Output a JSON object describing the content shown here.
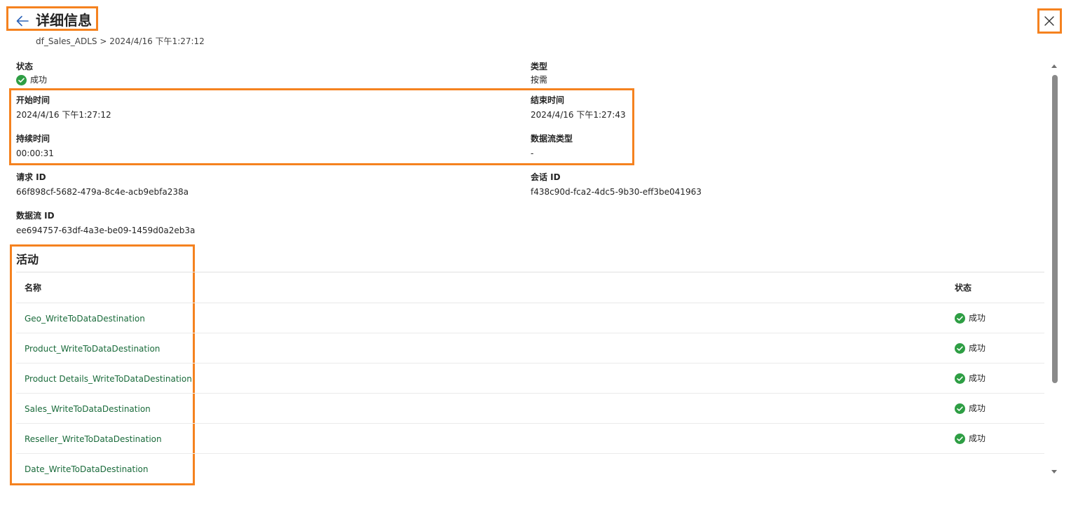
{
  "header": {
    "title": "详细信息",
    "breadcrumb": "df_Sales_ADLS > 2024/4/16 下午1:27:12"
  },
  "details": {
    "status_label": "状态",
    "status_value": "成功",
    "type_label": "类型",
    "type_value": "按需",
    "start_label": "开始时间",
    "start_value": "2024/4/16 下午1:27:12",
    "end_label": "结束时间",
    "end_value": "2024/4/16 下午1:27:43",
    "duration_label": "持续时间",
    "duration_value": "00:00:31",
    "flow_type_label": "数据流类型",
    "flow_type_value": "-",
    "request_id_label": "请求 ID",
    "request_id_value": "66f898cf-5682-479a-8c4e-acb9ebfa238a",
    "session_id_label": "会话 ID",
    "session_id_value": "f438c90d-fca2-4dc5-9b30-eff3be041963",
    "dataflow_id_label": "数据流 ID",
    "dataflow_id_value": "ee694757-63df-4a3e-be09-1459d0a2eb3a"
  },
  "activities": {
    "title": "活动",
    "columns": {
      "name": "名称",
      "status": "状态"
    },
    "rows": [
      {
        "name": "Geo_WriteToDataDestination",
        "status": "成功"
      },
      {
        "name": "Product_WriteToDataDestination",
        "status": "成功"
      },
      {
        "name": "Product Details_WriteToDataDestination",
        "status": "成功"
      },
      {
        "name": "Sales_WriteToDataDestination",
        "status": "成功"
      },
      {
        "name": "Reseller_WriteToDataDestination",
        "status": "成功"
      },
      {
        "name": "Date_WriteToDataDestination",
        "status": ""
      }
    ]
  },
  "colors": {
    "highlight": "#f5821f",
    "success": "#2e9e44",
    "link": "#1a6b3b"
  },
  "icons": {
    "back": "arrow-left-icon",
    "close": "close-icon",
    "status": "check-circle-icon"
  }
}
